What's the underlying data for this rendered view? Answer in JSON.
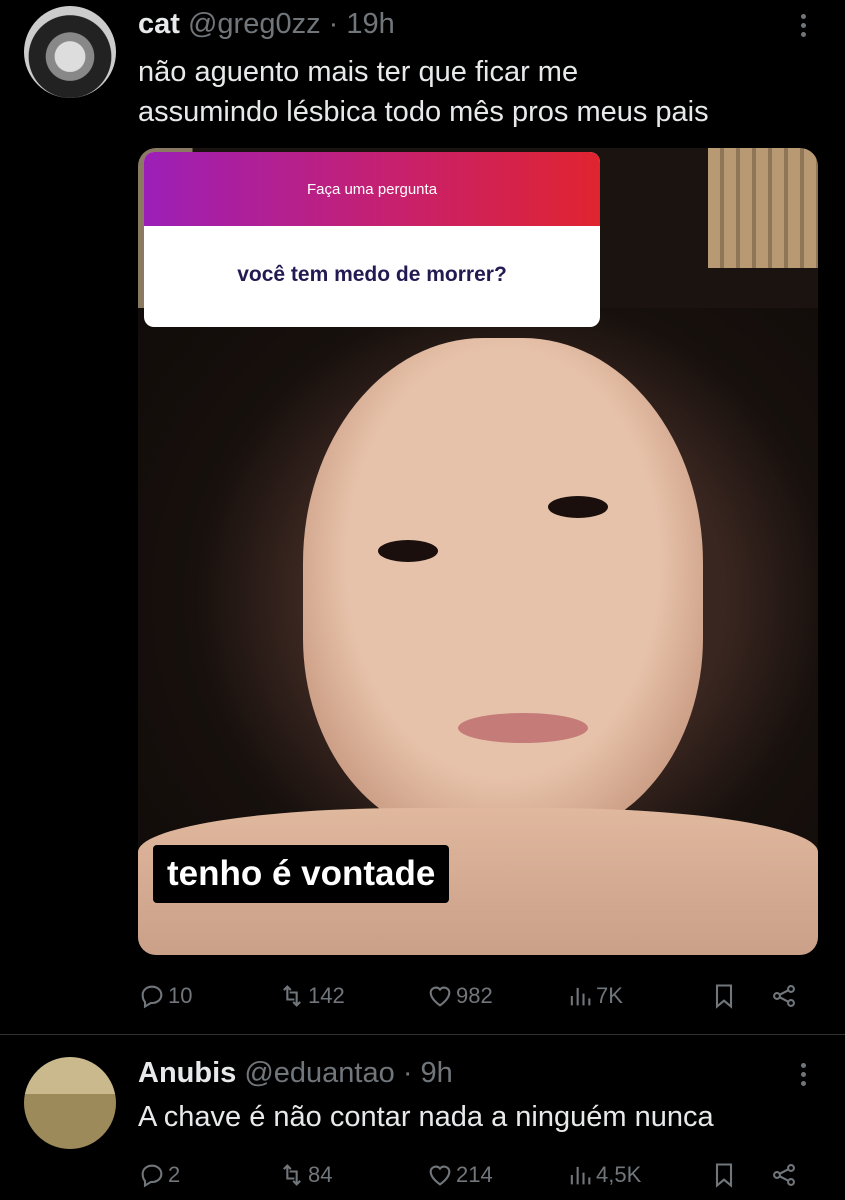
{
  "tweets": [
    {
      "name": "cat",
      "handle": "@greg0zz",
      "separator": "·",
      "time": "19h",
      "text_line1": "não aguento mais ter que ficar me",
      "text_line2": "assumindo lésbica todo mês pros meus pais",
      "media": {
        "question_header": "Faça uma pergunta",
        "question": "você tem medo de morrer?",
        "caption": "tenho é vontade"
      },
      "stats": {
        "replies": "10",
        "retweets": "142",
        "likes": "982",
        "views": "7K"
      }
    },
    {
      "name": "Anubis",
      "handle": "@eduantao",
      "separator": "·",
      "time": "9h",
      "text_line1": "A chave é não contar nada a ninguém nunca",
      "stats": {
        "replies": "2",
        "retweets": "84",
        "likes": "214",
        "views": "4,5K"
      }
    }
  ],
  "icons": {
    "reply": "reply-icon",
    "retweet": "retweet-icon",
    "like": "heart-icon",
    "views": "views-icon",
    "bookmark": "bookmark-icon",
    "share": "share-icon",
    "more": "more-icon"
  },
  "colors": {
    "background": "#000000",
    "text": "#e7e9ea",
    "muted": "#71767b",
    "divider": "#2f3336"
  }
}
